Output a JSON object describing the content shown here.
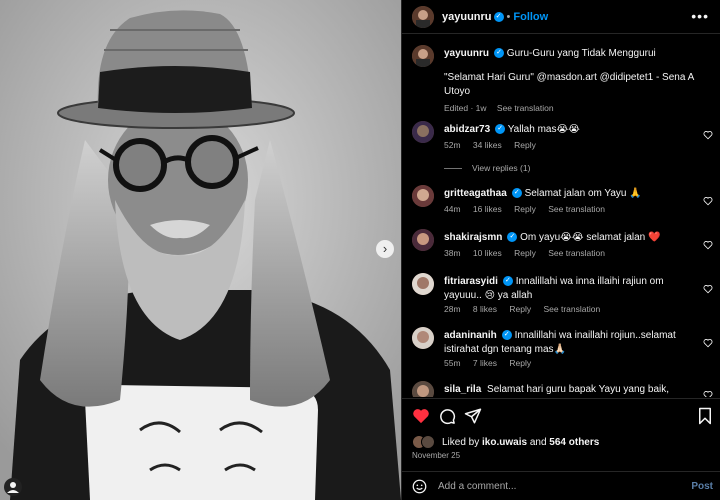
{
  "post": {
    "username": "yayuunru",
    "follow_label": "Follow",
    "separator": "•",
    "more_icon": "more-horizontal-icon"
  },
  "caption": {
    "username": "yayuunru",
    "line1": "Guru-Guru yang Tidak Menggurui",
    "line2": "\"Selamat Hari Guru\" @masdon.art @didipetet1 - Sena A Utoyo",
    "edited": "Edited · 1w",
    "see_translation": "See translation"
  },
  "comments": [
    {
      "username": "abidzar73",
      "verified": true,
      "text": "Yallah mas😭😭",
      "time": "52m",
      "likes": "34 likes",
      "reply": "Reply",
      "see_translation": "",
      "view_replies": "View replies (1)"
    },
    {
      "username": "gritteagathaa",
      "verified": true,
      "text": "Selamat jalan om Yayu 🙏",
      "time": "44m",
      "likes": "16 likes",
      "reply": "Reply",
      "see_translation": "See translation",
      "view_replies": ""
    },
    {
      "username": "shakirajsmn",
      "verified": true,
      "text": "Om yayu😭😭 selamat jalan ❤️",
      "time": "38m",
      "likes": "10 likes",
      "reply": "Reply",
      "see_translation": "See translation",
      "view_replies": ""
    },
    {
      "username": "fitriarasyidi",
      "verified": true,
      "text": "Innalillahi wa inna illaihi rajiun om yayuuu.. 😢 ya allah",
      "time": "28m",
      "likes": "8 likes",
      "reply": "Reply",
      "see_translation": "See translation",
      "view_replies": ""
    },
    {
      "username": "adaninanih",
      "verified": true,
      "text": "Innalillahi wa inaillahi rojiun..selamat istirahat dgn tenang mas🙏🏻",
      "time": "55m",
      "likes": "7 likes",
      "reply": "Reply",
      "see_translation": "",
      "view_replies": ""
    },
    {
      "username": "sila_rila",
      "verified": false,
      "text": "Selamat hari guru bapak Yayu yang baik, sehat dan",
      "time": "",
      "likes": "",
      "reply": "",
      "see_translation": "",
      "view_replies": ""
    }
  ],
  "actions": {
    "like_icon": "heart-filled-icon",
    "comment_icon": "comment-icon",
    "share_icon": "share-icon",
    "save_icon": "bookmark-icon",
    "liked_by_prefix": "Liked by",
    "liked_by_user": "iko.uwais",
    "liked_by_and": "and",
    "liked_by_others": "564 others",
    "date": "November 25"
  },
  "add_comment": {
    "placeholder": "Add a comment...",
    "post_label": "Post",
    "emoji_icon": "emoji-icon"
  },
  "colors": {
    "accent": "#0095f6",
    "like_red": "#ff3040",
    "muted": "#a8a8a8",
    "background": "#000000"
  }
}
